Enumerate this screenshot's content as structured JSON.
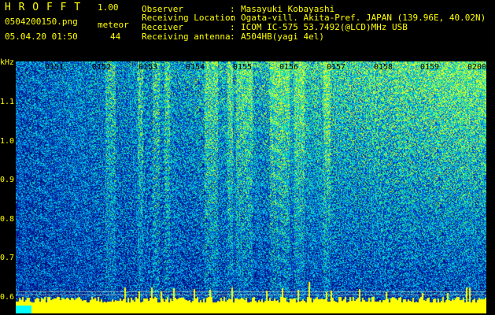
{
  "app": {
    "name": "H R O F F T",
    "version": "1.00"
  },
  "file": {
    "name": "0504200150.png",
    "datetime": "05.04.20 01:50"
  },
  "meteor": {
    "label": "meteor",
    "count": "44"
  },
  "info": [
    {
      "key": "Observer",
      "sep": ":",
      "value": "Masayuki Kobayashi"
    },
    {
      "key": "Receiving Location",
      "sep": ":",
      "value": "Ogata-vill. Akita-Pref. JAPAN (139.96E, 40.02N)"
    },
    {
      "key": "Receiver",
      "sep": ":",
      "value": "ICOM IC-575 53.7492(@LCD)MHz USB"
    },
    {
      "key": "Receiving antenna",
      "sep": ":",
      "value": "A504HB(yagi 4el)"
    }
  ],
  "axis": {
    "unit": "kHz",
    "y_ticks": [
      "1.1",
      "1.0",
      "0.9",
      "0.8",
      "0.7",
      "0.6"
    ],
    "x_ticks": [
      "0151",
      "0152",
      "0153",
      "0154",
      "0155",
      "0156",
      "0157",
      "0158",
      "0159",
      "0200"
    ]
  },
  "colors": {
    "text": "#ffff00",
    "background": "#000000",
    "noise_low": "#00008c",
    "noise_high": "#33ff66",
    "bottom_band": "#ffff00"
  }
}
